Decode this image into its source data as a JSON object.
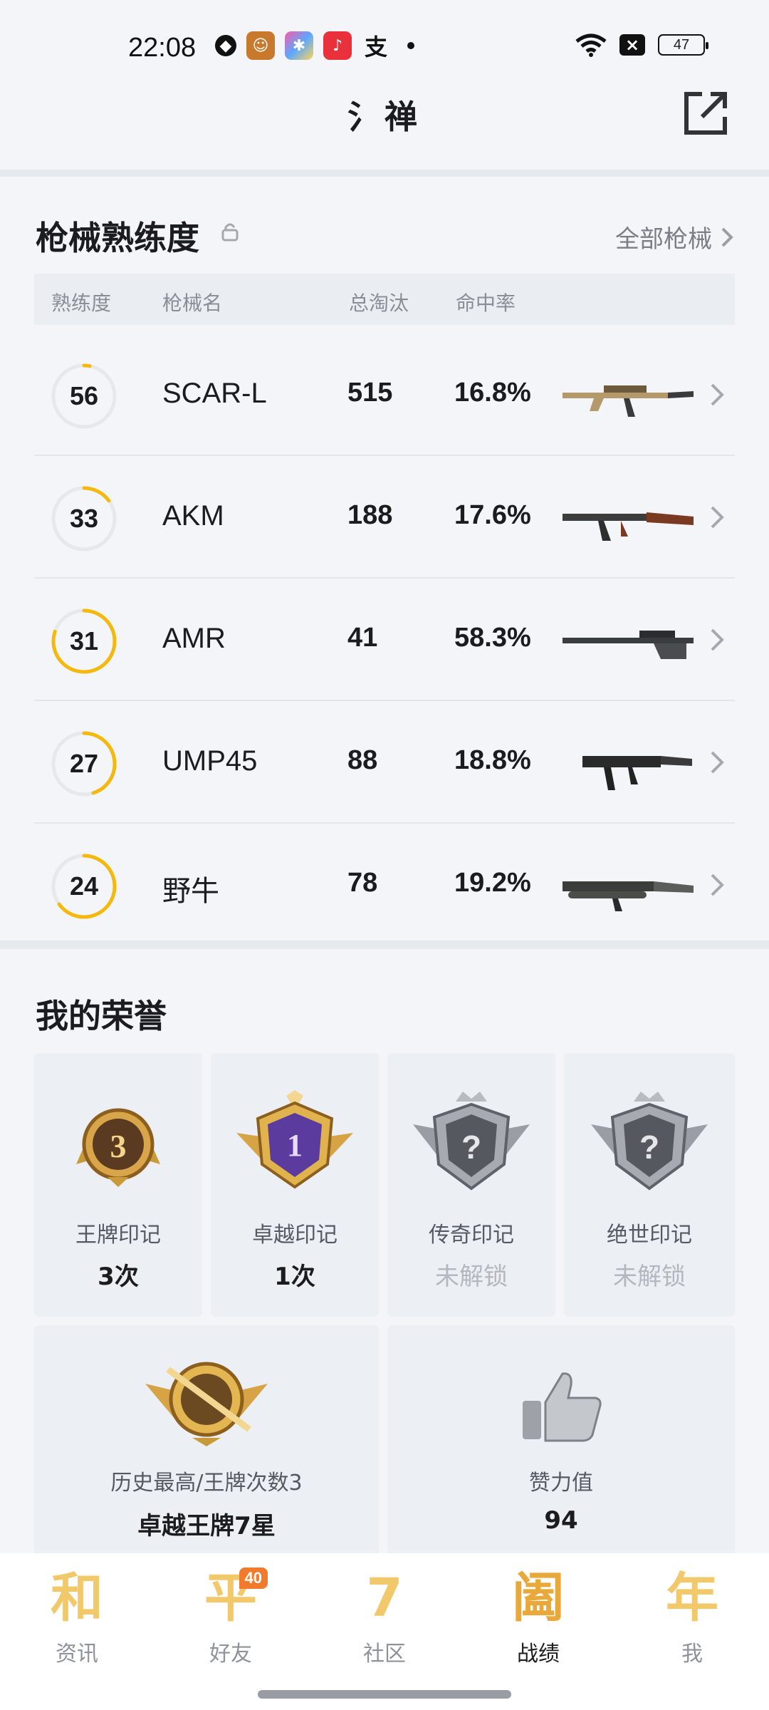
{
  "status_bar": {
    "time": "22:08",
    "battery": "47",
    "app_icons": [
      "shield-icon",
      "game-avatar-icon",
      "photos-icon",
      "music-icon",
      "alipay-icon"
    ]
  },
  "header": {
    "title": "氵禅",
    "share_icon": "share-icon"
  },
  "weapons": {
    "title": "枪械熟练度",
    "all_link": "全部枪械",
    "columns": [
      "熟练度",
      "枪械名",
      "总淘汰",
      "命中率"
    ],
    "rows": [
      {
        "level": "56",
        "name": "SCAR-L",
        "kills": "515",
        "accuracy": "16.8%",
        "progress": 0.03,
        "image": "scar-l-rifle"
      },
      {
        "level": "33",
        "name": "AKM",
        "kills": "188",
        "accuracy": "17.6%",
        "progress": 0.15,
        "image": "akm-rifle"
      },
      {
        "level": "31",
        "name": "AMR",
        "kills": "41",
        "accuracy": "58.3%",
        "progress": 0.8,
        "image": "amr-sniper"
      },
      {
        "level": "27",
        "name": "UMP45",
        "kills": "88",
        "accuracy": "18.8%",
        "progress": 0.45,
        "image": "ump45-smg"
      },
      {
        "level": "24",
        "name": "野牛",
        "kills": "78",
        "accuracy": "19.2%",
        "progress": 0.65,
        "image": "bizon-smg"
      }
    ]
  },
  "honors": {
    "title": "我的荣誉",
    "cards": [
      {
        "label": "王牌印记",
        "value": "3次",
        "emblem_num": "3",
        "locked": false
      },
      {
        "label": "卓越印记",
        "value": "1次",
        "emblem_num": "1",
        "locked": false
      },
      {
        "label": "传奇印记",
        "value": "未解锁",
        "emblem_num": "?",
        "locked": true
      },
      {
        "label": "绝世印记",
        "value": "未解锁",
        "emblem_num": "?",
        "locked": true
      }
    ],
    "highest": {
      "label": "历史最高/王牌次数3",
      "value": "卓越王牌7星"
    },
    "likes": {
      "label": "赞力值",
      "value": "94"
    }
  },
  "tabbar": {
    "tabs": [
      {
        "glyph": "和",
        "label": "资讯",
        "active": false
      },
      {
        "glyph": "平",
        "label": "好友",
        "active": false,
        "badge": "40"
      },
      {
        "glyph": "7",
        "label": "社区",
        "active": false
      },
      {
        "glyph": "阖",
        "label": "战绩",
        "active": true
      },
      {
        "glyph": "年",
        "label": "我",
        "active": false
      }
    ]
  },
  "colors": {
    "accent": "#f5b80c",
    "ring_bg": "#e6e8ec",
    "gold": "#c99a3a"
  }
}
